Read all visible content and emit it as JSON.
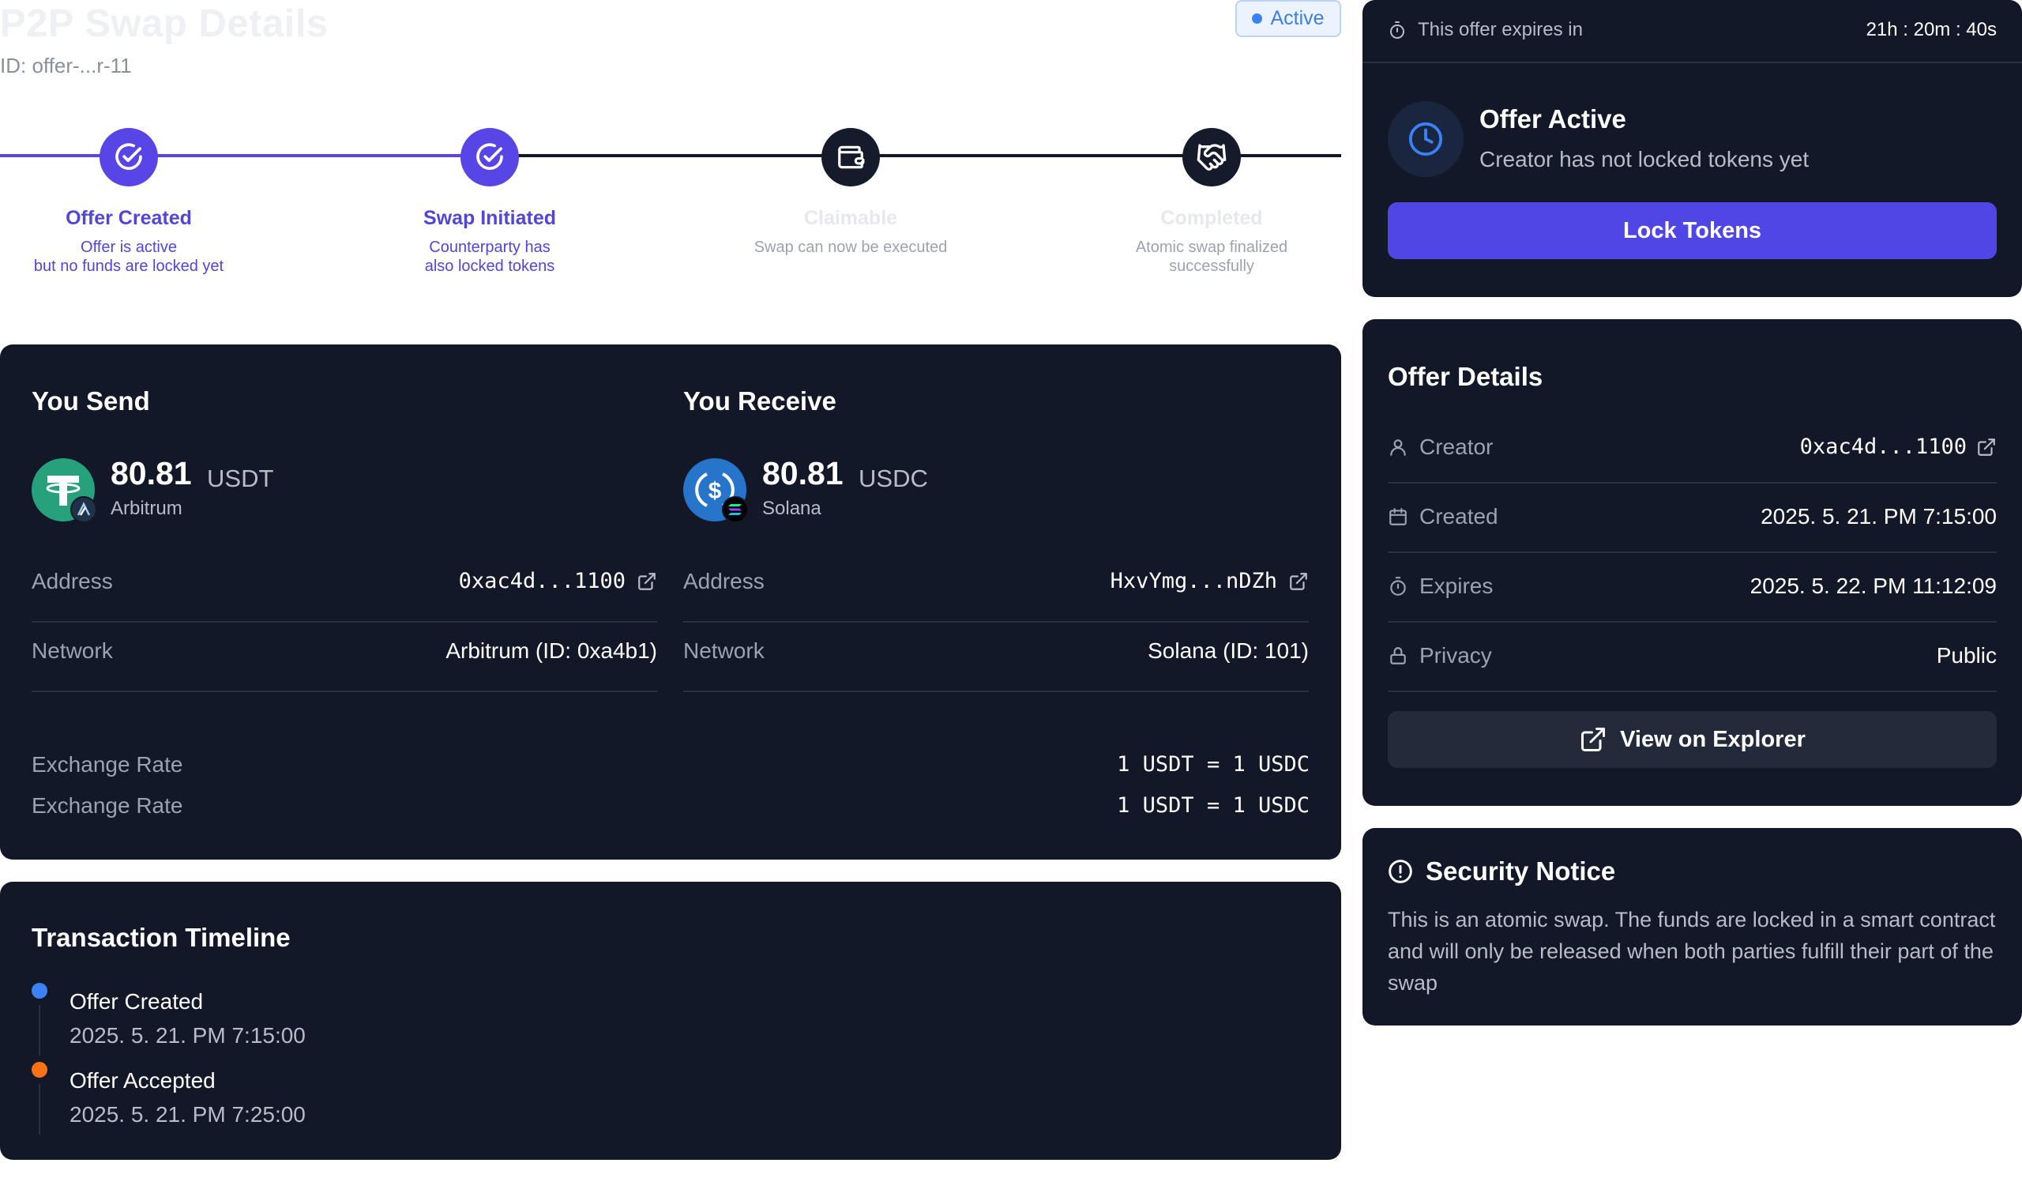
{
  "header": {
    "title": "P2P Swap Details",
    "offer_id": "ID: offer-...r-11",
    "status": "Active"
  },
  "steps": [
    {
      "title": "Offer Created",
      "desc_line1": "Offer is active",
      "desc_line2": "but no funds are locked yet",
      "state": "done",
      "icon": "check-circle-icon"
    },
    {
      "title": "Swap Initiated",
      "desc_line1": "Counterparty has",
      "desc_line2": "also locked tokens",
      "state": "done",
      "icon": "check-circle-icon"
    },
    {
      "title": "Claimable",
      "desc_line1": "Swap can now be executed",
      "desc_line2": "",
      "state": "todo",
      "icon": "wallet-icon"
    },
    {
      "title": "Completed",
      "desc_line1": "Atomic swap finalized",
      "desc_line2": "successfully",
      "state": "todo",
      "icon": "handshake-icon"
    }
  ],
  "send": {
    "heading": "You Send",
    "amount": "80.81",
    "symbol": "USDT",
    "chain": "Arbitrum",
    "address_label": "Address",
    "address": "0xac4d...1100",
    "network_label": "Network",
    "network": "Arbitrum (ID: 0xa4b1)"
  },
  "receive": {
    "heading": "You Receive",
    "amount": "80.81",
    "symbol": "USDC",
    "chain": "Solana",
    "address_label": "Address",
    "address": "HxvYmg...nDZh",
    "network_label": "Network",
    "network": "Solana (ID: 101)"
  },
  "exchange": [
    {
      "label": "Exchange Rate",
      "value": "1 USDT = 1 USDC"
    },
    {
      "label": "Exchange Rate",
      "value": "1 USDT = 1 USDC"
    }
  ],
  "timeline": {
    "title": "Transaction Timeline",
    "events": [
      {
        "title": "Offer Created",
        "date": "2025. 5. 21. PM 7:15:00",
        "color": "#3b82f6"
      },
      {
        "title": "Offer Accepted",
        "date": "2025. 5. 21. PM 7:25:00",
        "color": "#f97316"
      }
    ]
  },
  "expiry": {
    "label": "This offer expires in",
    "time": "21h : 20m : 40s",
    "status_title": "Offer Active",
    "status_sub": "Creator has not locked tokens yet",
    "lock_button": "Lock Tokens"
  },
  "details": {
    "title": "Offer Details",
    "rows": [
      {
        "label": "Creator",
        "value": "0xac4d...1100",
        "icon": "user-icon"
      },
      {
        "label": "Created",
        "value": "2025. 5. 21. PM 7:15:00",
        "icon": "calendar-icon"
      },
      {
        "label": "Expires",
        "value": "2025. 5. 22. PM 11:12:09",
        "icon": "timer-icon"
      },
      {
        "label": "Privacy",
        "value": "Public",
        "icon": "lock-icon"
      }
    ],
    "explorer_button": "View on Explorer"
  },
  "notice": {
    "title": "Security Notice",
    "body": "This is an atomic swap. The funds are locked in a smart contract and will only be released when both parties fulfill their part of the swap"
  },
  "colors": {
    "accent": "#4f46e5",
    "card_bg": "#121827",
    "usdt": "#26a17b",
    "usdc": "#2775ca"
  }
}
